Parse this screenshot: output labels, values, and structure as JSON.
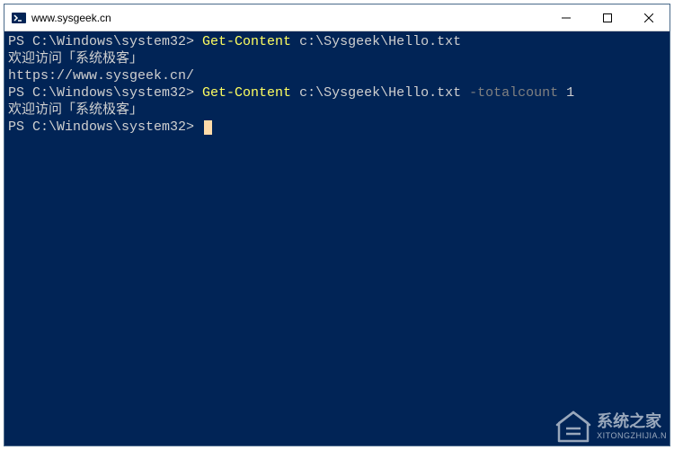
{
  "window": {
    "title": "www.sysgeek.cn"
  },
  "terminal": {
    "lines": [
      {
        "prompt": "PS C:\\Windows\\system32> ",
        "cmd": "Get-Content",
        "arg": " c:\\Sysgeek\\Hello.txt",
        "param": "",
        "paramval": ""
      },
      {
        "output": "欢迎访问「系统极客」"
      },
      {
        "output": ""
      },
      {
        "output": "https://www.sysgeek.cn/"
      },
      {
        "prompt": "PS C:\\Windows\\system32> ",
        "cmd": "Get-Content",
        "arg": " c:\\Sysgeek\\Hello.txt ",
        "param": "-totalcount",
        "paramval": " 1"
      },
      {
        "output": "欢迎访问「系统极客」"
      },
      {
        "prompt": "PS C:\\Windows\\system32> ",
        "cmd": "",
        "arg": "",
        "param": "",
        "paramval": "",
        "cursor": true
      }
    ]
  },
  "watermark": {
    "title": "系统之家",
    "sub": "XITONGZHIJIA.N"
  }
}
